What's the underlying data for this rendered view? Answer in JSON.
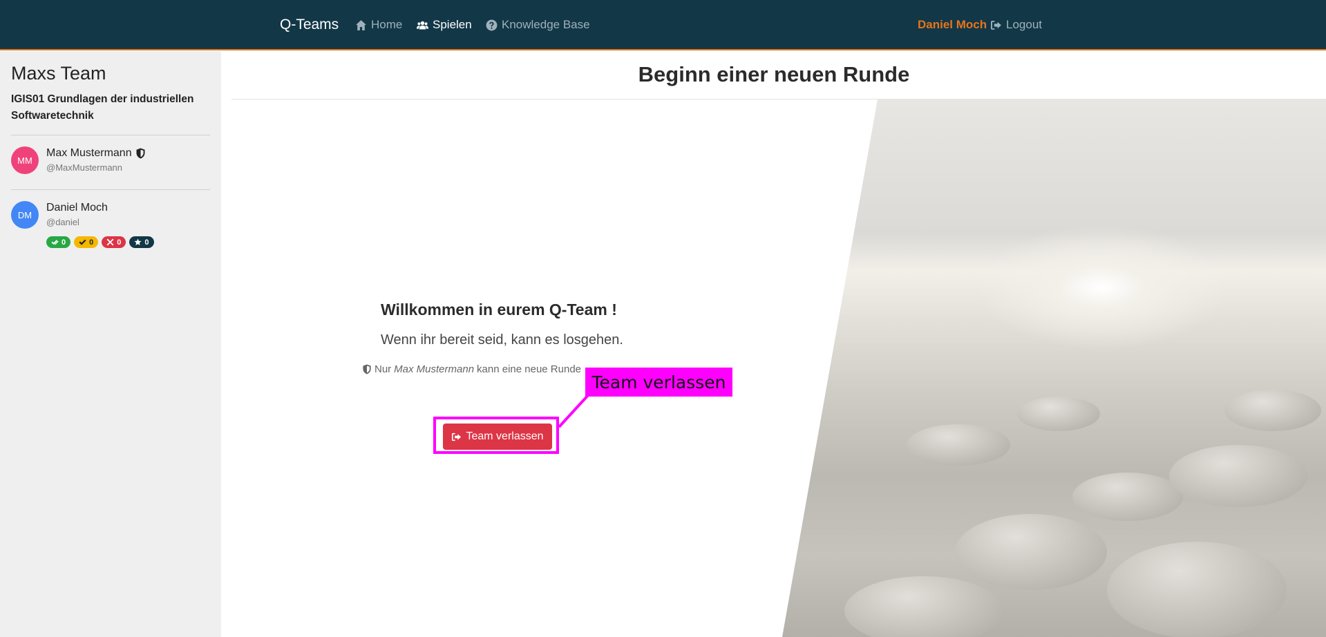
{
  "navbar": {
    "brand": "Q-Teams",
    "links": [
      {
        "label": "Home",
        "icon": "home-icon"
      },
      {
        "label": "Spielen",
        "icon": "users-icon"
      },
      {
        "label": "Knowledge Base",
        "icon": "question-circle-icon"
      }
    ],
    "user": "Daniel Moch",
    "logout": "Logout",
    "colors": {
      "background": "#123747",
      "accent": "#e8741a"
    }
  },
  "sidebar": {
    "team_name": "Maxs Team",
    "course": "IGIS01 Grundlagen der industriellen Softwaretechnik",
    "members": [
      {
        "initials": "MM",
        "name": "Max Mustermann",
        "handle": "@MaxMustermann",
        "avatar_color": "#f0427a",
        "leader": true
      },
      {
        "initials": "DM",
        "name": "Daniel Moch",
        "handle": "@daniel",
        "avatar_color": "#4287f5",
        "badges": [
          {
            "icon": "check-double-icon",
            "value": "0",
            "color": "#28a745"
          },
          {
            "icon": "check-icon",
            "value": "0",
            "color": "#f5b800"
          },
          {
            "icon": "times-icon",
            "value": "0",
            "color": "#dc3545"
          },
          {
            "icon": "star-icon",
            "value": "0",
            "color": "#123747"
          }
        ]
      }
    ]
  },
  "main": {
    "title": "Beginn einer neuen Runde",
    "welcome_heading": "Willkommen in eurem Q-Team !",
    "welcome_text": "Wenn ihr bereit seid, kann es losgehen.",
    "note_prefix": "Nur",
    "note_name": "Max Mustermann",
    "note_suffix": "kann eine neue Runde",
    "leave_button": "Team verlassen",
    "leave_button_color": "#dc3545"
  },
  "annotation": {
    "label": "Team verlassen",
    "color": "#ff00ff"
  }
}
